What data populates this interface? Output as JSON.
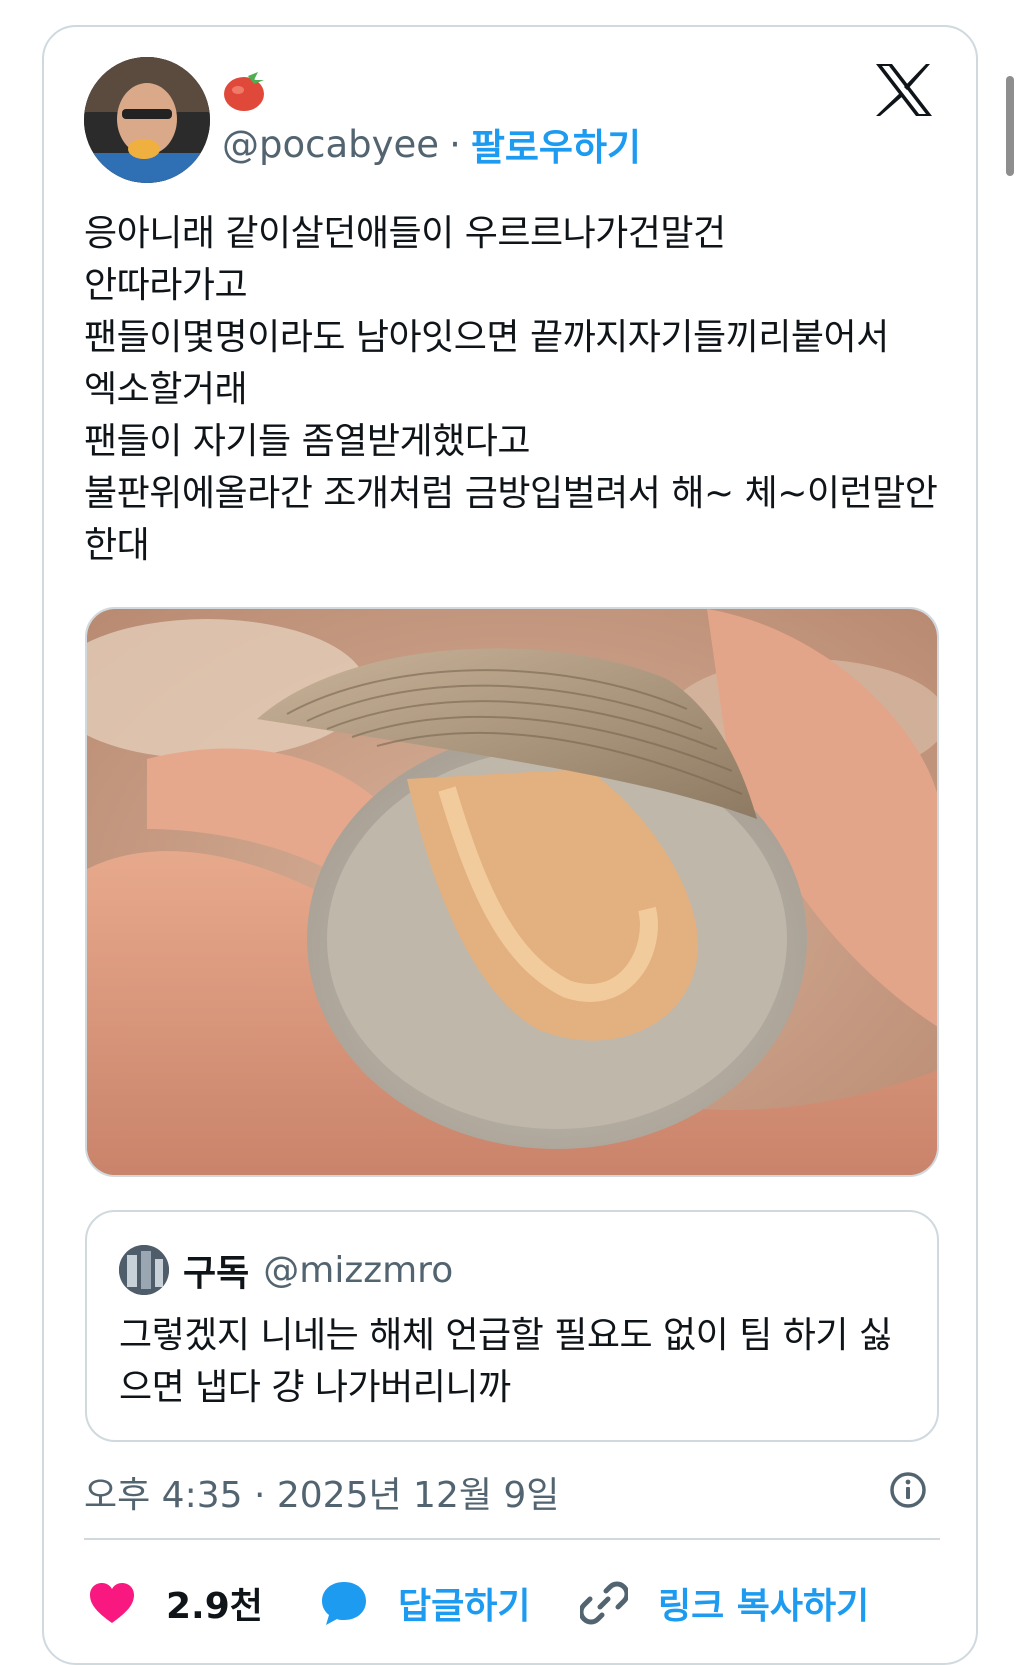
{
  "author": {
    "handle": "@pocabyee",
    "separator": "·",
    "follow_label": "팔로우하기"
  },
  "tweet": {
    "lines": [
      "응아니래 같이살던애들이 우르르나가건말건",
      "안따라가고",
      "팬들이몇명이라도 남아잇으면 끝까지자기들끼리붙어서",
      "엑소할거래",
      "팬들이 자기들 좀열받게했다고",
      "불판위에올라간 조개처럼 금방입벌려서 해~ 체~이런말안",
      "한대"
    ]
  },
  "quote": {
    "name": "구독",
    "handle": "@mizzmro",
    "lines": [
      "그렇겠지 니네는 해체 언급할 필요도 없이 팀 하기 싫",
      "으면 냅다 걍 나가버리니까"
    ]
  },
  "meta": {
    "timestamp": "오후 4:35 · 2025년 12월 9일"
  },
  "actions": {
    "likes_count": "2.9천",
    "reply_label": "답글하기",
    "copy_link_label": "링크 복사하기"
  },
  "icons": {
    "like": "heart-icon",
    "reply": "speech-bubble-icon",
    "copy": "link-icon",
    "info": "info-icon",
    "brand": "x-logo-icon",
    "badge": "tomato-emoji-icon"
  },
  "colors": {
    "accent": "#1d9bf0",
    "like": "#f91880",
    "secondary_text": "#536471",
    "border": "#cfd9de"
  }
}
